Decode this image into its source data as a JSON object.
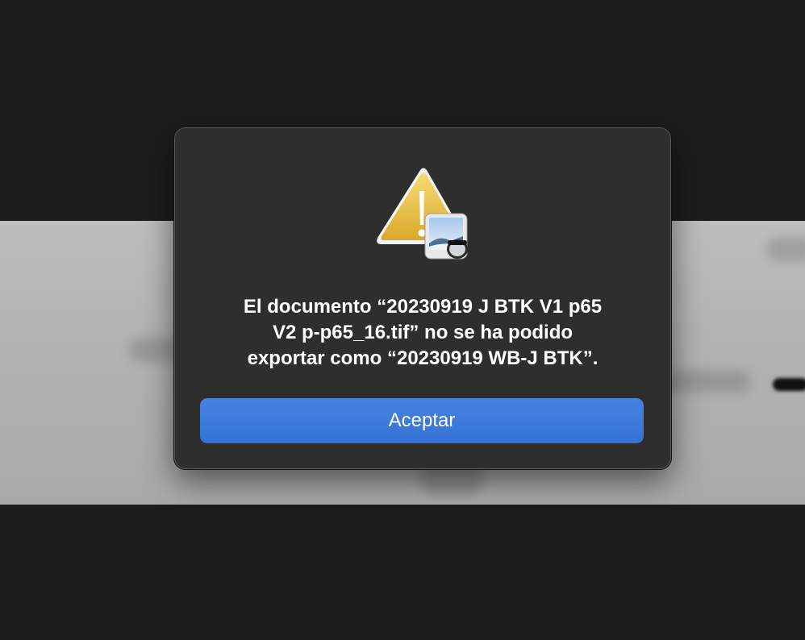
{
  "dialog": {
    "message_line1": "El documento “20230919 J BTK V1 p65",
    "message_line2": "V2 p-p65_16.tif” no se ha podido",
    "message_line3": "exportar como “20230919 WB-J BTK”.",
    "accept_label": "Aceptar",
    "icon": "warning-triangle-icon",
    "app_badge_icon": "preview-app-icon"
  },
  "colors": {
    "dialog_bg": "#2e2e2c",
    "accent": "#3a77dc",
    "warning": "#e8c24a",
    "backdrop": "#1c1c1b"
  }
}
